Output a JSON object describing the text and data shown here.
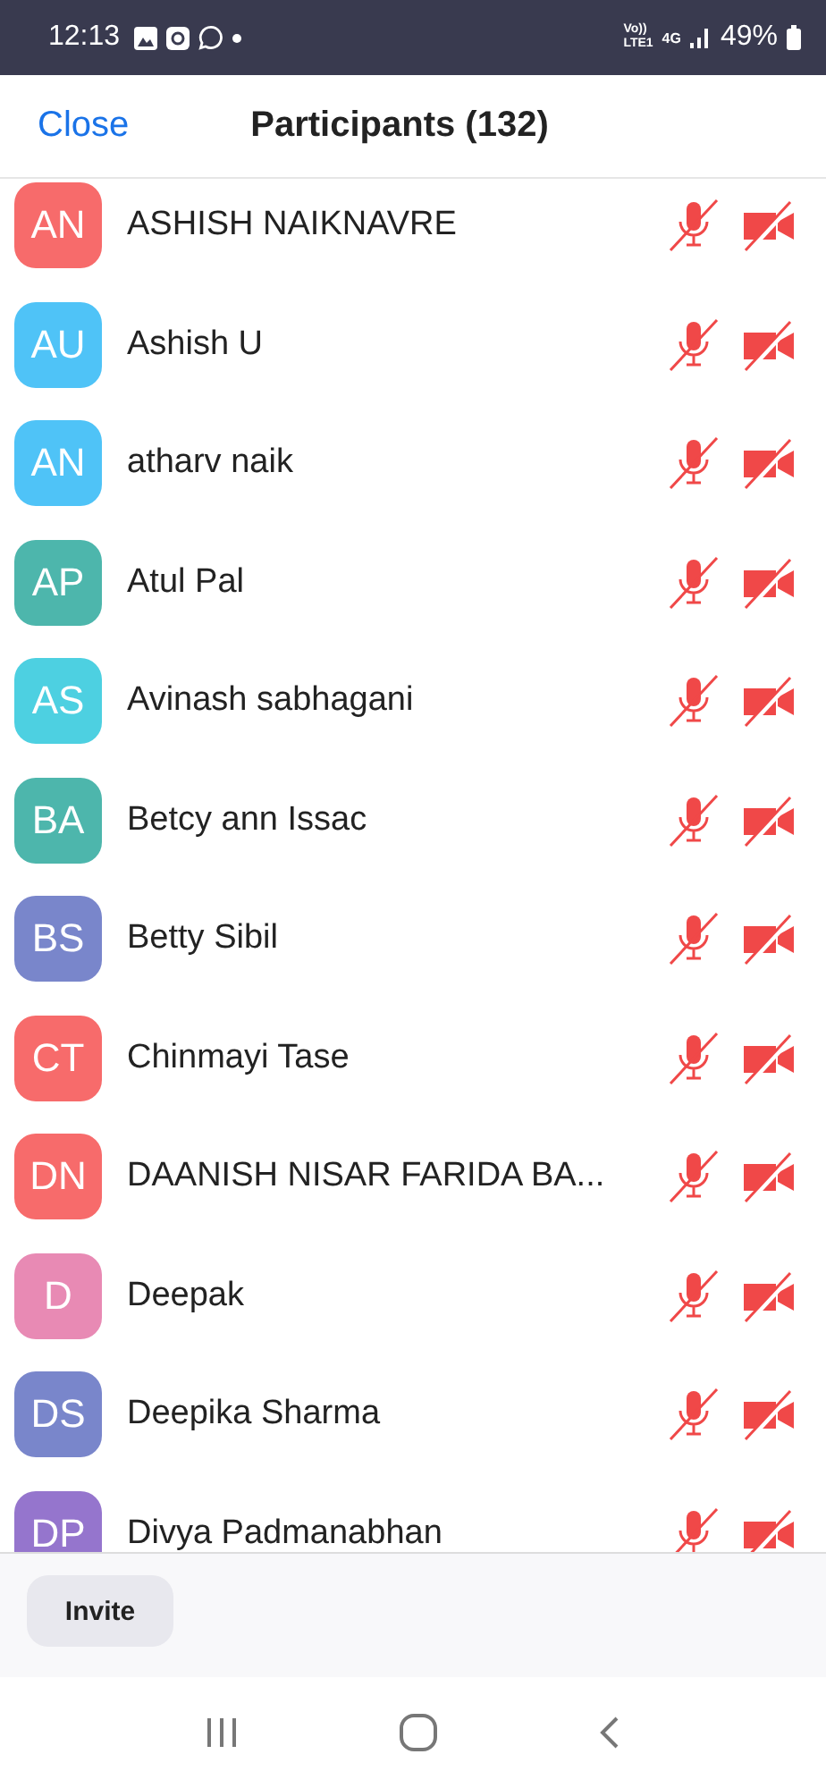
{
  "status_bar": {
    "time": "12:13",
    "volte": "Vo))",
    "lte": "LTE1",
    "network": "4G",
    "battery": "49%"
  },
  "header": {
    "close": "Close",
    "title": "Participants (132)"
  },
  "participants": [
    {
      "initials": "AN",
      "name": "ASHISH NAIKNAVRE",
      "color": "#f76b6b",
      "muted": true,
      "video_off": true
    },
    {
      "initials": "AU",
      "name": "Ashish U",
      "color": "#4fc3f7",
      "muted": true,
      "video_off": true
    },
    {
      "initials": "AN",
      "name": "atharv naik",
      "color": "#4fc3f7",
      "muted": true,
      "video_off": true
    },
    {
      "initials": "AP",
      "name": "Atul Pal",
      "color": "#4db6ac",
      "muted": true,
      "video_off": true
    },
    {
      "initials": "AS",
      "name": "Avinash sabhagani",
      "color": "#4dd0e1",
      "muted": true,
      "video_off": true
    },
    {
      "initials": "BA",
      "name": "Betcy ann Issac",
      "color": "#4db6ac",
      "muted": true,
      "video_off": true
    },
    {
      "initials": "BS",
      "name": "Betty Sibil",
      "color": "#7986cb",
      "muted": true,
      "video_off": true
    },
    {
      "initials": "CT",
      "name": "Chinmayi Tase",
      "color": "#f76b6b",
      "muted": true,
      "video_off": true
    },
    {
      "initials": "DN",
      "name": "DAANISH NISAR FARIDA BA...",
      "color": "#f76b6b",
      "muted": true,
      "video_off": true
    },
    {
      "initials": "D",
      "name": "Deepak",
      "color": "#e88ab4",
      "muted": true,
      "video_off": true
    },
    {
      "initials": "DS",
      "name": "Deepika Sharma",
      "color": "#7986cb",
      "muted": true,
      "video_off": true
    },
    {
      "initials": "DP",
      "name": "Divya Padmanabhan",
      "color": "#9575cd",
      "muted": true,
      "video_off": true
    }
  ],
  "footer": {
    "invite": "Invite"
  }
}
